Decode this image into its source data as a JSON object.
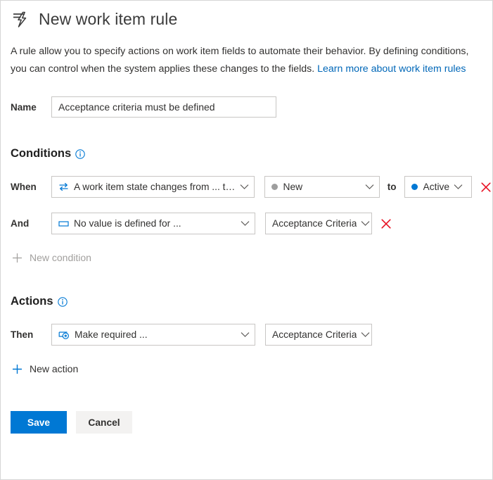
{
  "window": {
    "title": "New work item rule",
    "title_icon": "rule-lightning-icon"
  },
  "description": {
    "line1": "A rule allow you to specify actions on work item fields to automate their behavior. By defining conditions,",
    "line2": "you can control when the system applies these changes to the fields.",
    "link_text": "Learn more about work item rules"
  },
  "name_field": {
    "label": "Name",
    "value": "Acceptance criteria must be defined",
    "placeholder": "Name"
  },
  "conditions": {
    "heading": "Conditions",
    "info_icon": "info-circle-icon",
    "rows": [
      {
        "label": "When",
        "kind": {
          "value": "A work item state changes from ... to ...",
          "icon": "state-transition-arrows-icon"
        },
        "from_state": {
          "value": "New",
          "dot_color": "#9e9e9e"
        },
        "separator": "to",
        "to_state": {
          "value": "Active",
          "dot_color": "#0078d4"
        },
        "delete_icon": "delete-x-icon"
      },
      {
        "label": "And",
        "kind": {
          "value": "No value is defined for ...",
          "icon": "empty-field-rectangle-icon"
        },
        "field": {
          "value": "Acceptance Criteria"
        },
        "delete_icon": "delete-x-icon"
      }
    ],
    "add_link": {
      "label": "New condition",
      "icon": "plus-icon",
      "enabled": false
    }
  },
  "actions": {
    "heading": "Actions",
    "info_icon": "info-circle-icon",
    "rows": [
      {
        "label": "Then",
        "kind": {
          "value": "Make required ...",
          "icon": "make-required-field-icon"
        },
        "field": {
          "value": "Acceptance Criteria"
        }
      }
    ],
    "add_link": {
      "label": "New action",
      "icon": "plus-icon",
      "enabled": true
    }
  },
  "footer": {
    "save_label": "Save",
    "cancel_label": "Cancel"
  },
  "colors": {
    "accent": "#0078d4",
    "link": "#0067b8",
    "delete": "#e81123",
    "border": "#c8c6c4",
    "disabled_text": "#a19f9d"
  }
}
